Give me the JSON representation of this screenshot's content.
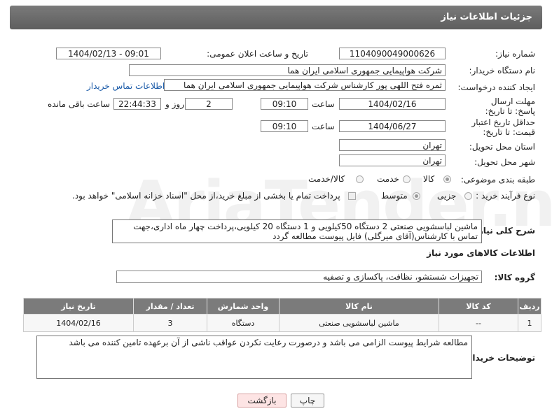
{
  "header": {
    "title": "جزئیات اطلاعات نیاز"
  },
  "fields": {
    "need_number_label": "شماره نیاز:",
    "need_number": "1104090049000626",
    "announce_label": "تاریخ و ساعت اعلان عمومی:",
    "announce_value": "1404/02/13 - 09:01",
    "buyer_label": "نام دستگاه خریدار:",
    "buyer_value": "شرکت هواپیمایی جمهوری اسلامی ایران هما",
    "creator_label": "ایجاد کننده درخواست:",
    "creator_value": "ثمره فتح اللهی پور کارشناس شرکت هواپیمایی جمهوری اسلامی ایران هما",
    "contact_link": "اطلاعات تماس خریدار",
    "deadline_label": "مهلت ارسال پاسخ: تا تاریخ:",
    "deadline_date": "1404/02/16",
    "time_label": "ساعت",
    "deadline_time": "09:10",
    "days_value": "2",
    "days_label": "روز و",
    "remaining_value": "22:44:33",
    "remaining_label": "ساعت باقی مانده",
    "validity_label": "حداقل تاریخ اعتبار قیمت: تا تاریخ:",
    "validity_date": "1404/06/27",
    "validity_time": "09:10",
    "province_label": "استان محل تحویل:",
    "province_value": "تهران",
    "city_label": "شهر محل تحویل:",
    "city_value": "تهران",
    "category_label": "طبقه بندی موضوعی:",
    "category_options": [
      "کالا",
      "خدمت",
      "کالا/خدمت"
    ],
    "process_label": "نوع فرآیند خرید :",
    "process_options": [
      "جزیی",
      "متوسط"
    ],
    "payment_note": "پرداخت تمام یا بخشی از مبلغ خرید،از محل \"اسناد خزانه اسلامی\" خواهد بود."
  },
  "description": {
    "label": "شرح کلی نیاز:",
    "text": "ماشین لباسشویی صنعتی 2 دستگاه 50کیلویی و 1 دستگاه 20 کیلویی،پرداخت چهار ماه اداری،جهت تماس با کارشناس(آقای میرگلی) فایل پیوست مطالعه گردد"
  },
  "goods_section": {
    "title": "اطلاعات کالاهای مورد نیاز",
    "group_label": "گروه کالا:",
    "group_value": "تجهیزات شستشو، نظافت، پاکسازی و تصفیه"
  },
  "table": {
    "headers": [
      "ردیف",
      "کد کالا",
      "نام کالا",
      "واحد شمارش",
      "تعداد / مقدار",
      "تاریخ نیاز"
    ],
    "rows": [
      [
        "1",
        "--",
        "ماشین لباسشویی صنعتی",
        "دستگاه",
        "3",
        "1404/02/16"
      ]
    ]
  },
  "buyer_notes": {
    "label": "توضیحات خریدار:",
    "text": "مطالعه شرایط پیوست الزامی می باشد و درصورت رعایت نکردن عواقب ناشی از آن برعهده تامین کننده می باشد"
  },
  "buttons": {
    "print": "چاپ",
    "back": "بازگشت"
  },
  "watermark": "AriaTender.neT"
}
